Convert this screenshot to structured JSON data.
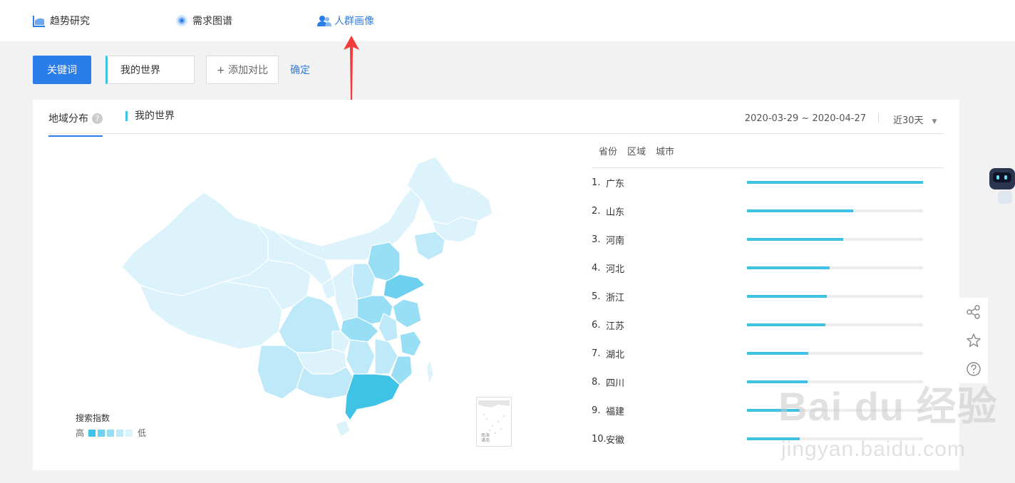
{
  "nav": {
    "items": [
      {
        "label": "趋势研究",
        "icon": "trend-chart-icon"
      },
      {
        "label": "需求图谱",
        "icon": "target-circle-icon"
      },
      {
        "label": "人群画像",
        "icon": "users-icon"
      }
    ]
  },
  "keyword_bar": {
    "keyword_button": "关键词",
    "keyword_value": "我的世界",
    "add_compare": "+ 添加对比",
    "confirm": "确定"
  },
  "panel": {
    "tab_title": "地域分布",
    "help_icon_text": "?",
    "series_label": "我的世界",
    "date_range": "2020-03-29 ~ 2020-04-27",
    "period": "近30天"
  },
  "legend": {
    "title": "搜索指数",
    "high": "高",
    "low": "低",
    "colors": [
      "#3ec3e6",
      "#6dd0ef",
      "#98def4",
      "#bee9f8",
      "#dcf3fc"
    ]
  },
  "ranking": {
    "tabs": [
      "省份",
      "区域",
      "城市"
    ],
    "rows": [
      {
        "rank": "1.",
        "name": "广东",
        "value": 1.0
      },
      {
        "rank": "2.",
        "name": "山东",
        "value": 0.605
      },
      {
        "rank": "3.",
        "name": "河南",
        "value": 0.545
      },
      {
        "rank": "4.",
        "name": "河北",
        "value": 0.47
      },
      {
        "rank": "5.",
        "name": "浙江",
        "value": 0.452
      },
      {
        "rank": "6.",
        "name": "江苏",
        "value": 0.445
      },
      {
        "rank": "7.",
        "name": "湖北",
        "value": 0.35
      },
      {
        "rank": "8.",
        "name": "四川",
        "value": 0.345
      },
      {
        "rank": "9.",
        "name": "福建",
        "value": 0.3
      },
      {
        "rank": "10.",
        "name": "安徽",
        "value": 0.3
      }
    ]
  },
  "map": {
    "scs_label": "南海诸岛"
  },
  "side_tools": [
    "share-icon",
    "star-icon",
    "question-icon"
  ],
  "watermark": {
    "text": "Bai du 经验",
    "url": "jingyan.baidu.com"
  },
  "accent": "#2b7de9"
}
